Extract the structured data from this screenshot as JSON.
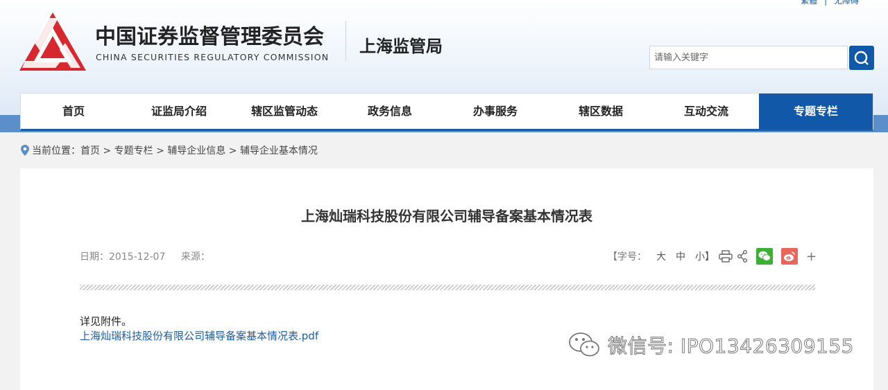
{
  "header": {
    "top_links": [
      "繁體",
      "|",
      "无障碍"
    ],
    "logo_cn": "中国证券监督管理委员会",
    "logo_en": "CHINA SECURITIES REGULATORY COMMISSION",
    "bureau": "上海监管局",
    "search_placeholder": "请输入关键字",
    "brand_color": "#1159a8",
    "logo_color": "#d7282f"
  },
  "nav": {
    "items": [
      "首页",
      "证监局介绍",
      "辖区监管动态",
      "政务信息",
      "办事服务",
      "辖区数据",
      "互动交流",
      "专题专栏"
    ],
    "active_index": 7
  },
  "breadcrumb": {
    "prefix": "当前位置：",
    "path": "首页 > 专题专栏 > 辅导企业信息 > 辅导企业基本情况"
  },
  "article": {
    "title": "上海灿瑞科技股份有限公司辅导备案基本情况表",
    "date_text": "日期：2015-12-07",
    "source_text": "来源：",
    "font_size_label": "【字号：",
    "font_large": "大",
    "font_medium": "中",
    "font_small": "小】",
    "body": "详见附件。",
    "attachment": "上海灿瑞科技股份有限公司辅导备案基本情况表.pdf",
    "share_plus": "+",
    "icons": [
      "print-icon",
      "share-icon",
      "wechat-icon",
      "weibo-icon"
    ]
  },
  "watermark": {
    "text": "微信号: IPO13426309155"
  }
}
